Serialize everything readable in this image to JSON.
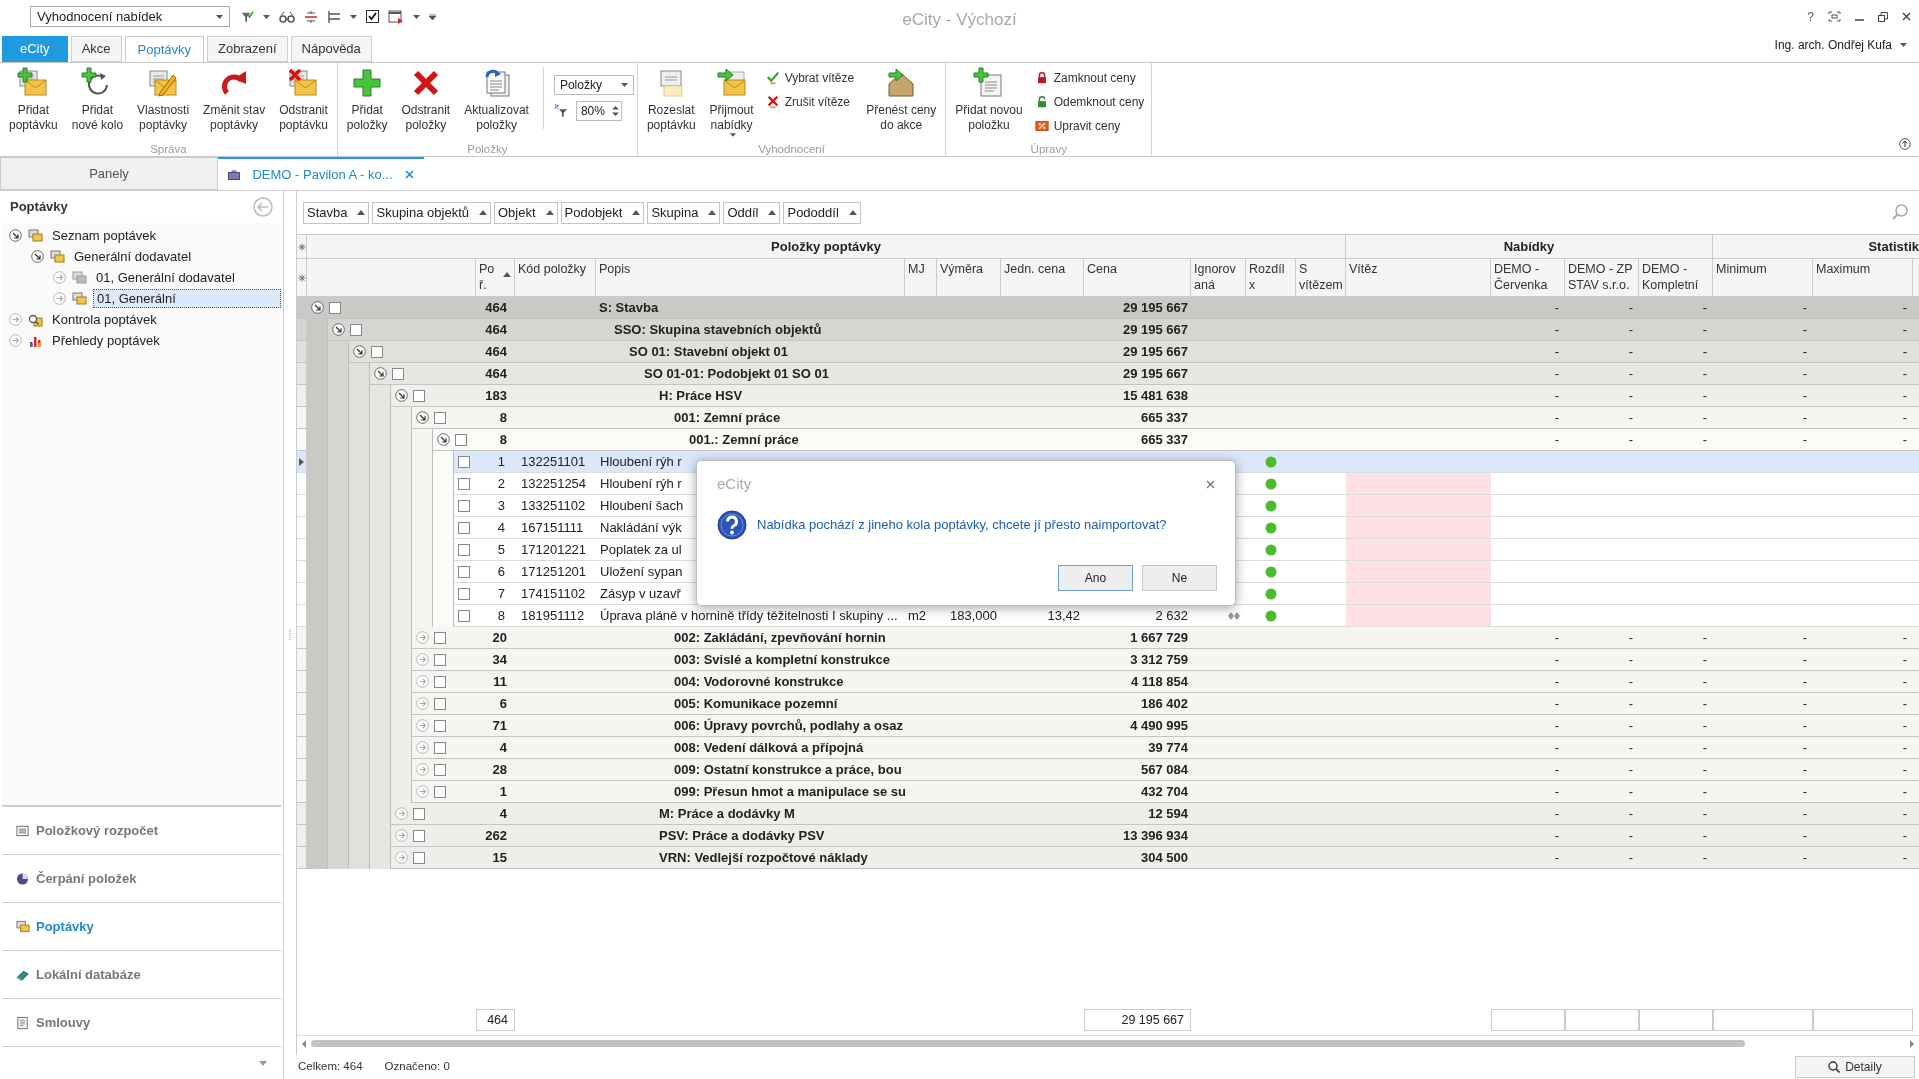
{
  "toolbar": {
    "view_select": "Vyhodnocení nabídek"
  },
  "window": {
    "title": "eCity - Výchozí",
    "help": "?",
    "user": "Ing. arch. Ondřej Kufa"
  },
  "ribbon_tabs": [
    {
      "label": "eCity",
      "kind": "app",
      "selected": false
    },
    {
      "label": "Akce",
      "kind": "tab",
      "selected": false
    },
    {
      "label": "Poptávky",
      "kind": "tab",
      "selected": true
    },
    {
      "label": "Zobrazení",
      "kind": "tab",
      "selected": false
    },
    {
      "label": "Nápověda",
      "kind": "tab",
      "selected": false
    }
  ],
  "ribbon_groups": [
    {
      "label": "Správa",
      "items": [
        {
          "kind": "large",
          "lines": [
            "Přidat",
            "poptávku"
          ]
        },
        {
          "kind": "large",
          "lines": [
            "Přidat",
            "nové kolo"
          ]
        },
        {
          "kind": "large",
          "lines": [
            "Vlastnosti",
            "poptávky"
          ]
        },
        {
          "kind": "large",
          "lines": [
            "Změnit stav",
            "poptávky"
          ]
        },
        {
          "kind": "large",
          "lines": [
            "Odstranit",
            "poptávku"
          ]
        }
      ]
    },
    {
      "label": "Položky",
      "items": [
        {
          "kind": "large",
          "lines": [
            "Přidat",
            "položky"
          ]
        },
        {
          "kind": "large",
          "lines": [
            "Odstranit",
            "položky"
          ]
        },
        {
          "kind": "large",
          "lines": [
            "Aktualizovat",
            "položky"
          ]
        },
        {
          "kind": "view",
          "select": "Položky",
          "zoom": "80%"
        }
      ]
    },
    {
      "label": "Vyhodnocení",
      "items": [
        {
          "kind": "large",
          "lines": [
            "Rozeslat",
            "poptávku"
          ]
        },
        {
          "kind": "large",
          "lines": [
            "Přijmout",
            "nabídky"
          ],
          "menu": true
        },
        {
          "kind": "stack",
          "entries": [
            "Vybrat vítěze",
            "Zrušit vítěze"
          ]
        },
        {
          "kind": "large",
          "lines": [
            "Přenést ceny",
            "do akce"
          ]
        }
      ]
    },
    {
      "label": "Úpravy",
      "items": [
        {
          "kind": "large",
          "lines": [
            "Přidat novou",
            "položku"
          ]
        },
        {
          "kind": "stack",
          "entries": [
            "Zamknout ceny",
            "Odemknout ceny",
            "Upravit ceny"
          ]
        }
      ]
    }
  ],
  "panel_tabs": [
    {
      "label": "Panely",
      "selected": false
    },
    {
      "label": "DEMO - Pavilon A - ko...",
      "selected": true
    }
  ],
  "sidebar": {
    "title": "Poptávky",
    "tree": [
      {
        "label": "Seznam poptávek",
        "kind": "docs",
        "expanded": true,
        "selected": false,
        "children": [
          {
            "label": "Generální dodavatel",
            "kind": "docs",
            "expanded": true,
            "selected": false,
            "children": [
              {
                "label": "01, Generální dodavatel",
                "kind": "docs-gray",
                "expanded": false,
                "selected": false
              },
              {
                "label": "01, Generální",
                "kind": "docs",
                "expanded": false,
                "selected": true
              }
            ]
          }
        ]
      },
      {
        "label": "Kontrola poptávek",
        "kind": "check",
        "expanded": false,
        "selected": false
      },
      {
        "label": "Přehledy poptávek",
        "kind": "chart",
        "expanded": false,
        "selected": false
      }
    ],
    "nav": [
      {
        "label": "Položkový rozpočet",
        "selected": false
      },
      {
        "label": "Čerpání položek",
        "selected": false
      },
      {
        "label": "Poptávky",
        "selected": true
      },
      {
        "label": "Lokální databáze",
        "selected": false
      },
      {
        "label": "Smlouvy",
        "selected": false
      }
    ]
  },
  "grid": {
    "group_by": [
      "Stavba",
      "Skupina objektů",
      "Objekt",
      "Podobjekt",
      "Skupina",
      "Oddíl",
      "Pododdíl"
    ],
    "bands": [
      "Položky poptávky",
      "Nabídky",
      "Statistik"
    ],
    "columns": [
      {
        "lines": [
          "Po",
          "ř."
        ],
        "sorted": true
      },
      {
        "lines": [
          "Kód položky"
        ],
        "sorted": false
      },
      {
        "lines": [
          "Popis"
        ],
        "sorted": false
      },
      {
        "lines": [
          "MJ"
        ],
        "sorted": false
      },
      {
        "lines": [
          "Výměra"
        ],
        "sorted": false
      },
      {
        "lines": [
          "Jedn. cena"
        ],
        "sorted": false
      },
      {
        "lines": [
          "Cena"
        ],
        "sorted": false
      },
      {
        "lines": [
          "Ignorov",
          "aná"
        ],
        "sorted": false
      },
      {
        "lines": [
          "Rozdíl",
          "x"
        ],
        "sorted": false
      },
      {
        "lines": [
          "S",
          "vítězem"
        ],
        "sorted": false
      },
      {
        "lines": [
          "Vítěz"
        ],
        "sorted": false
      },
      {
        "lines": [
          "DEMO -",
          "Červenka"
        ],
        "sorted": false
      },
      {
        "lines": [
          "DEMO - ZP",
          "STAV s.r.o."
        ],
        "sorted": false
      },
      {
        "lines": [
          "DEMO -",
          "Kompletní"
        ],
        "sorted": false
      },
      {
        "lines": [
          "Minimum"
        ],
        "sorted": false
      },
      {
        "lines": [
          "Maximum"
        ],
        "sorted": false
      }
    ],
    "rows": [
      {
        "kind": "group",
        "count": "464",
        "label": "S: Stavba",
        "price": "29 195 667",
        "offers": [
          "-",
          "-",
          "-"
        ],
        "stats": [
          "-",
          "-"
        ],
        "expanded": true,
        "checked": false,
        "selected": false,
        "children": [
          {
            "kind": "group",
            "count": "464",
            "label": "SSO: Skupina stavebních objektů",
            "price": "29 195 667",
            "offers": [
              "-",
              "-",
              "-"
            ],
            "stats": [
              "-",
              "-"
            ],
            "expanded": true,
            "checked": false,
            "selected": false,
            "children": [
              {
                "kind": "group",
                "count": "464",
                "label": "SO 01: Stavební objekt 01",
                "price": "29 195 667",
                "offers": [
                  "-",
                  "-",
                  "-"
                ],
                "stats": [
                  "-",
                  "-"
                ],
                "expanded": true,
                "checked": false,
                "selected": false,
                "children": [
                  {
                    "kind": "group",
                    "count": "464",
                    "label": "SO 01-01: Podobjekt 01 SO 01",
                    "price": "29 195 667",
                    "offers": [
                      "-",
                      "-",
                      "-"
                    ],
                    "stats": [
                      "-",
                      "-"
                    ],
                    "expanded": true,
                    "checked": false,
                    "selected": false,
                    "children": [
                      {
                        "kind": "group",
                        "count": "183",
                        "label": "H: Práce HSV",
                        "price": "15 481 638",
                        "offers": [
                          "-",
                          "-",
                          "-"
                        ],
                        "stats": [
                          "-",
                          "-"
                        ],
                        "expanded": true,
                        "checked": false,
                        "selected": false,
                        "children": [
                          {
                            "kind": "group",
                            "count": "8",
                            "label": "001: Zemní práce",
                            "price": "665 337",
                            "offers": [
                              "-",
                              "-",
                              "-"
                            ],
                            "stats": [
                              "-",
                              "-"
                            ],
                            "expanded": true,
                            "checked": false,
                            "selected": false,
                            "children": [
                              {
                                "kind": "group",
                                "count": "8",
                                "label": "001.: Zemní práce",
                                "price": "665 337",
                                "offers": [
                                  "-",
                                  "-",
                                  "-"
                                ],
                                "stats": [
                                  "-",
                                  "-"
                                ],
                                "expanded": true,
                                "checked": false,
                                "selected": false,
                                "children": [
                                  {
                                    "kind": "item",
                                    "no": "1",
                                    "code": "132251101",
                                    "label": "Hloubení rýh r",
                                    "color": "#4cbb2e",
                                    "winner_missing": false,
                                    "marker": false,
                                    "checked": false,
                                    "selected": true
                                  },
                                  {
                                    "kind": "item",
                                    "no": "2",
                                    "code": "132251254",
                                    "label": "Hloubení rýh r",
                                    "color": "#4cbb2e",
                                    "winner_missing": true,
                                    "marker": false,
                                    "checked": false,
                                    "selected": false
                                  },
                                  {
                                    "kind": "item",
                                    "no": "3",
                                    "code": "133251102",
                                    "label": "Hloubení šach",
                                    "color": "#4cbb2e",
                                    "winner_missing": true,
                                    "marker": false,
                                    "checked": false,
                                    "selected": false
                                  },
                                  {
                                    "kind": "item",
                                    "no": "4",
                                    "code": "167151111",
                                    "label": "Nakládání výk",
                                    "color": "#4cbb2e",
                                    "winner_missing": true,
                                    "marker": false,
                                    "checked": false,
                                    "selected": false
                                  },
                                  {
                                    "kind": "item",
                                    "no": "5",
                                    "code": "171201221",
                                    "label": "Poplatek za ul",
                                    "color": "#4cbb2e",
                                    "winner_missing": true,
                                    "marker": false,
                                    "checked": false,
                                    "selected": false
                                  },
                                  {
                                    "kind": "item",
                                    "no": "6",
                                    "code": "171251201",
                                    "label": "Uložení sypan",
                                    "color": "#4cbb2e",
                                    "winner_missing": true,
                                    "marker": false,
                                    "checked": false,
                                    "selected": false
                                  },
                                  {
                                    "kind": "item",
                                    "no": "7",
                                    "code": "174151102",
                                    "label": "Zásyp v uzavř",
                                    "color": "#4cbb2e",
                                    "winner_missing": true,
                                    "marker": false,
                                    "checked": false,
                                    "selected": false
                                  },
                                  {
                                    "kind": "item",
                                    "no": "8",
                                    "code": "181951112",
                                    "label": "Úprava pláně v hornině třídy těžitelnosti I skupiny ...",
                                    "unit": "m2",
                                    "qty": "183,000",
                                    "unit_price": "13,42",
                                    "price": "2 632",
                                    "color": "#4cbb2e",
                                    "winner_missing": true,
                                    "marker": true,
                                    "checked": false,
                                    "selected": false
                                  }
                                ]
                              }
                            ]
                          },
                          {
                            "kind": "group",
                            "count": "20",
                            "label": "002: Zakládání, zpevňování hornin",
                            "price": "1 667 729",
                            "offers": [
                              "-",
                              "-",
                              "-"
                            ],
                            "stats": [
                              "-",
                              "-"
                            ],
                            "expanded": false,
                            "checked": false,
                            "selected": false
                          },
                          {
                            "kind": "group",
                            "count": "34",
                            "label": "003: Svislé a kompletní konstrukce",
                            "price": "3 312 759",
                            "offers": [
                              "-",
                              "-",
                              "-"
                            ],
                            "stats": [
                              "-",
                              "-"
                            ],
                            "expanded": false,
                            "checked": false,
                            "selected": false
                          },
                          {
                            "kind": "group",
                            "count": "11",
                            "label": "004: Vodorovné konstrukce",
                            "price": "4 118 854",
                            "offers": [
                              "-",
                              "-",
                              "-"
                            ],
                            "stats": [
                              "-",
                              "-"
                            ],
                            "expanded": false,
                            "checked": false,
                            "selected": false
                          },
                          {
                            "kind": "group",
                            "count": "6",
                            "label": "005: Komunikace pozemní",
                            "price": "186 402",
                            "offers": [
                              "-",
                              "-",
                              "-"
                            ],
                            "stats": [
                              "-",
                              "-"
                            ],
                            "expanded": false,
                            "checked": false,
                            "selected": false
                          },
                          {
                            "kind": "group",
                            "count": "71",
                            "label": "006: Úpravy povrchů, podlahy a osaz",
                            "price": "4 490 995",
                            "offers": [
                              "-",
                              "-",
                              "-"
                            ],
                            "stats": [
                              "-",
                              "-"
                            ],
                            "expanded": false,
                            "checked": false,
                            "selected": false
                          },
                          {
                            "kind": "group",
                            "count": "4",
                            "label": "008: Vedení dálková a přípojná",
                            "price": "39 774",
                            "offers": [
                              "-",
                              "-",
                              "-"
                            ],
                            "stats": [
                              "-",
                              "-"
                            ],
                            "expanded": false,
                            "checked": false,
                            "selected": false
                          },
                          {
                            "kind": "group",
                            "count": "28",
                            "label": "009: Ostatní konstrukce a práce, bou",
                            "price": "567 084",
                            "offers": [
                              "-",
                              "-",
                              "-"
                            ],
                            "stats": [
                              "-",
                              "-"
                            ],
                            "expanded": false,
                            "checked": false,
                            "selected": false
                          },
                          {
                            "kind": "group",
                            "count": "1",
                            "label": "099: Přesun hmot a manipulace se su",
                            "price": "432 704",
                            "offers": [
                              "-",
                              "-",
                              "-"
                            ],
                            "stats": [
                              "-",
                              "-"
                            ],
                            "expanded": false,
                            "checked": false,
                            "selected": false
                          }
                        ]
                      },
                      {
                        "kind": "group",
                        "count": "4",
                        "label": "M: Práce a dodávky M",
                        "price": "12 594",
                        "offers": [
                          "-",
                          "-",
                          "-"
                        ],
                        "stats": [
                          "-",
                          "-"
                        ],
                        "expanded": false,
                        "checked": false,
                        "selected": false
                      },
                      {
                        "kind": "group",
                        "count": "262",
                        "label": "PSV: Práce a dodávky PSV",
                        "price": "13 396 934",
                        "offers": [
                          "-",
                          "-",
                          "-"
                        ],
                        "stats": [
                          "-",
                          "-"
                        ],
                        "expanded": false,
                        "checked": false,
                        "selected": false
                      },
                      {
                        "kind": "group",
                        "count": "15",
                        "label": "VRN: Vedlejší rozpočtové náklady",
                        "price": "304 500",
                        "offers": [
                          "-",
                          "-",
                          "-"
                        ],
                        "stats": [
                          "-",
                          "-"
                        ],
                        "expanded": false,
                        "checked": false,
                        "selected": false
                      }
                    ]
                  }
                ]
              }
            ]
          }
        ]
      }
    ],
    "footer": {
      "count": "464",
      "total": "29 195 667"
    }
  },
  "status_bar": {
    "total": "Celkem: 464",
    "marked": "Označeno: 0",
    "details_button": "Detaily"
  },
  "dialog": {
    "title": "eCity",
    "message": "Nabídka pochází z jineho kola poptávky, chcete jí přesto naimportovat?",
    "buttons": [
      {
        "label": "Ano",
        "default": true
      },
      {
        "label": "Ne",
        "default": false
      }
    ]
  }
}
